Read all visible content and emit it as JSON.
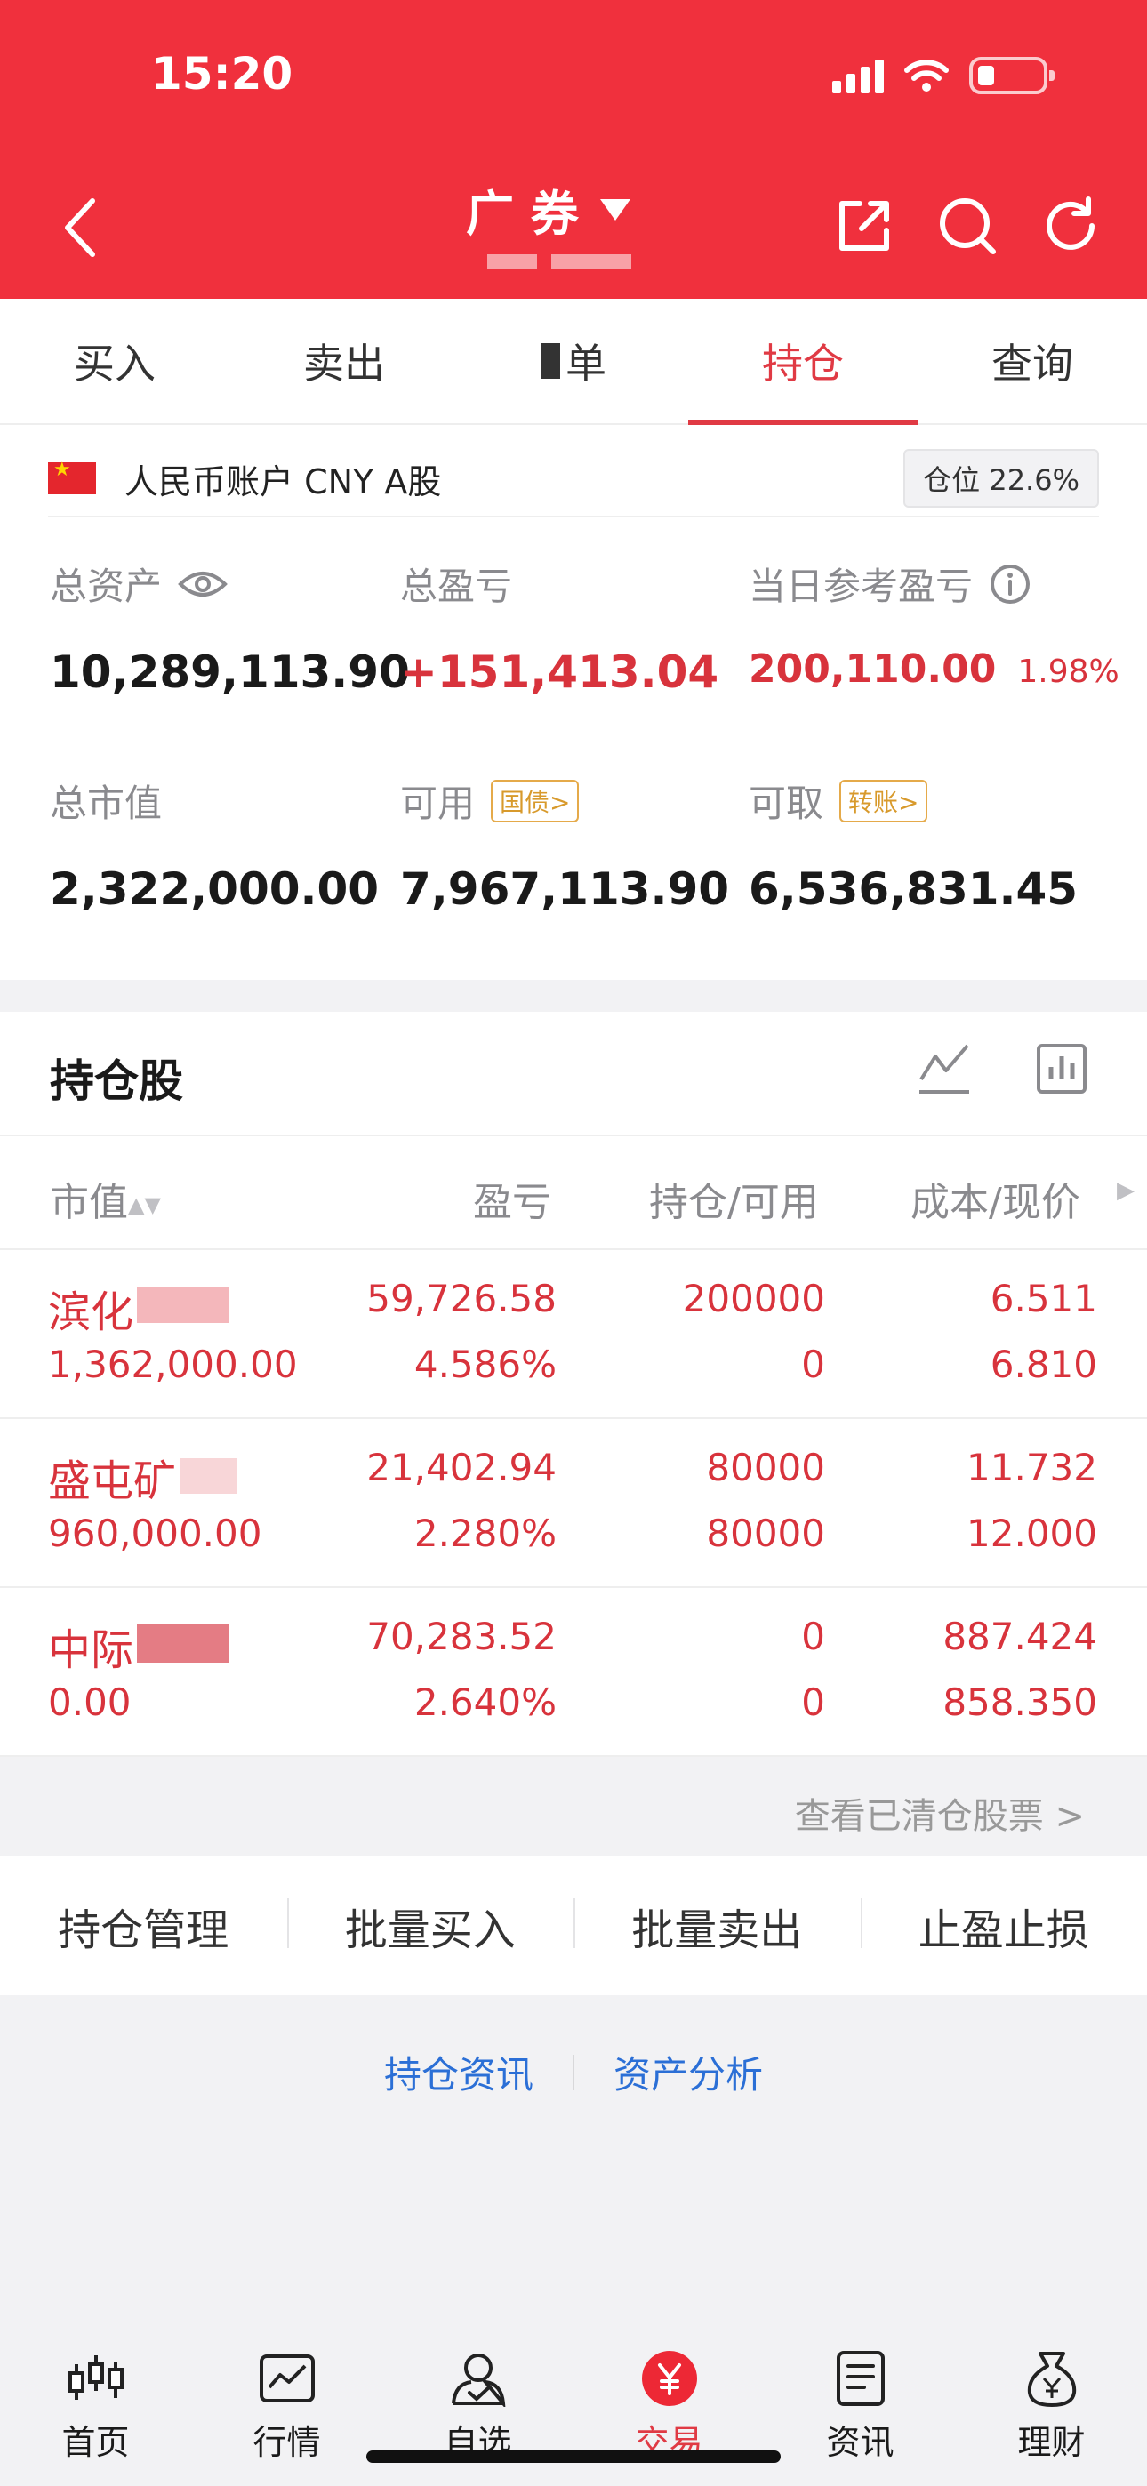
{
  "status_bar": {
    "time": "15:20"
  },
  "header": {
    "title": "广  券"
  },
  "tabs": [
    {
      "label": "买入"
    },
    {
      "label": "卖出"
    },
    {
      "label": "单"
    },
    {
      "label": "持仓"
    },
    {
      "label": "查询"
    }
  ],
  "account": {
    "label": "人民币账户 CNY A股",
    "position_ratio": "仓位 22.6%",
    "total_assets_label": "总资产",
    "total_assets": "10,289,113.90",
    "total_pnl_label": "总盈亏",
    "total_pnl": "+151,413.04",
    "daily_pnl_label": "当日参考盈亏",
    "daily_pnl": "200,110.00",
    "daily_pnl_pct": "1.98%",
    "market_value_label": "总市值",
    "market_value": "2,322,000.00",
    "available_label": "可用",
    "available_tag": "国债>",
    "available": "7,967,113.90",
    "withdrawable_label": "可取",
    "withdrawable_tag": "转账>",
    "withdrawable": "6,536,831.45"
  },
  "holdings": {
    "title": "持仓股",
    "columns": {
      "market_value": "市值",
      "pnl": "盈亏",
      "position": "持仓/可用",
      "cost": "成本/现价"
    },
    "rows": [
      {
        "name": "滨化",
        "value": "1,362,000.00",
        "pnl": "59,726.58",
        "pnl_pct": "4.586%",
        "position": "200000",
        "available": "0",
        "cost": "6.511",
        "price": "6.810"
      },
      {
        "name": "盛屯矿",
        "value": "960,000.00",
        "pnl": "21,402.94",
        "pnl_pct": "2.280%",
        "position": "80000",
        "available": "80000",
        "cost": "11.732",
        "price": "12.000"
      },
      {
        "name": "中际",
        "value": "0.00",
        "pnl": "70,283.52",
        "pnl_pct": "2.640%",
        "position": "0",
        "available": "0",
        "cost": "887.424",
        "price": "858.350"
      }
    ]
  },
  "cleared_link": "查看已清仓股票 >",
  "actions": [
    {
      "label": "持仓管理"
    },
    {
      "label": "批量买入"
    },
    {
      "label": "批量卖出"
    },
    {
      "label": "止盈止损"
    }
  ],
  "links": {
    "news": "持仓资讯",
    "analysis": "资产分析"
  },
  "bottom_nav": [
    {
      "label": "首页",
      "icon": "candlestick-icon"
    },
    {
      "label": "行情",
      "icon": "chart-icon"
    },
    {
      "label": "自选",
      "icon": "user-check-icon"
    },
    {
      "label": "交易",
      "icon": "yuan-icon"
    },
    {
      "label": "资讯",
      "icon": "document-icon"
    },
    {
      "label": "理财",
      "icon": "money-bag-icon"
    }
  ],
  "colors": {
    "brand_red": "#f0303d",
    "loss_profit_red": "#d8333c",
    "link_blue": "#2b6fd6",
    "tag_gold": "#d89a2c"
  }
}
